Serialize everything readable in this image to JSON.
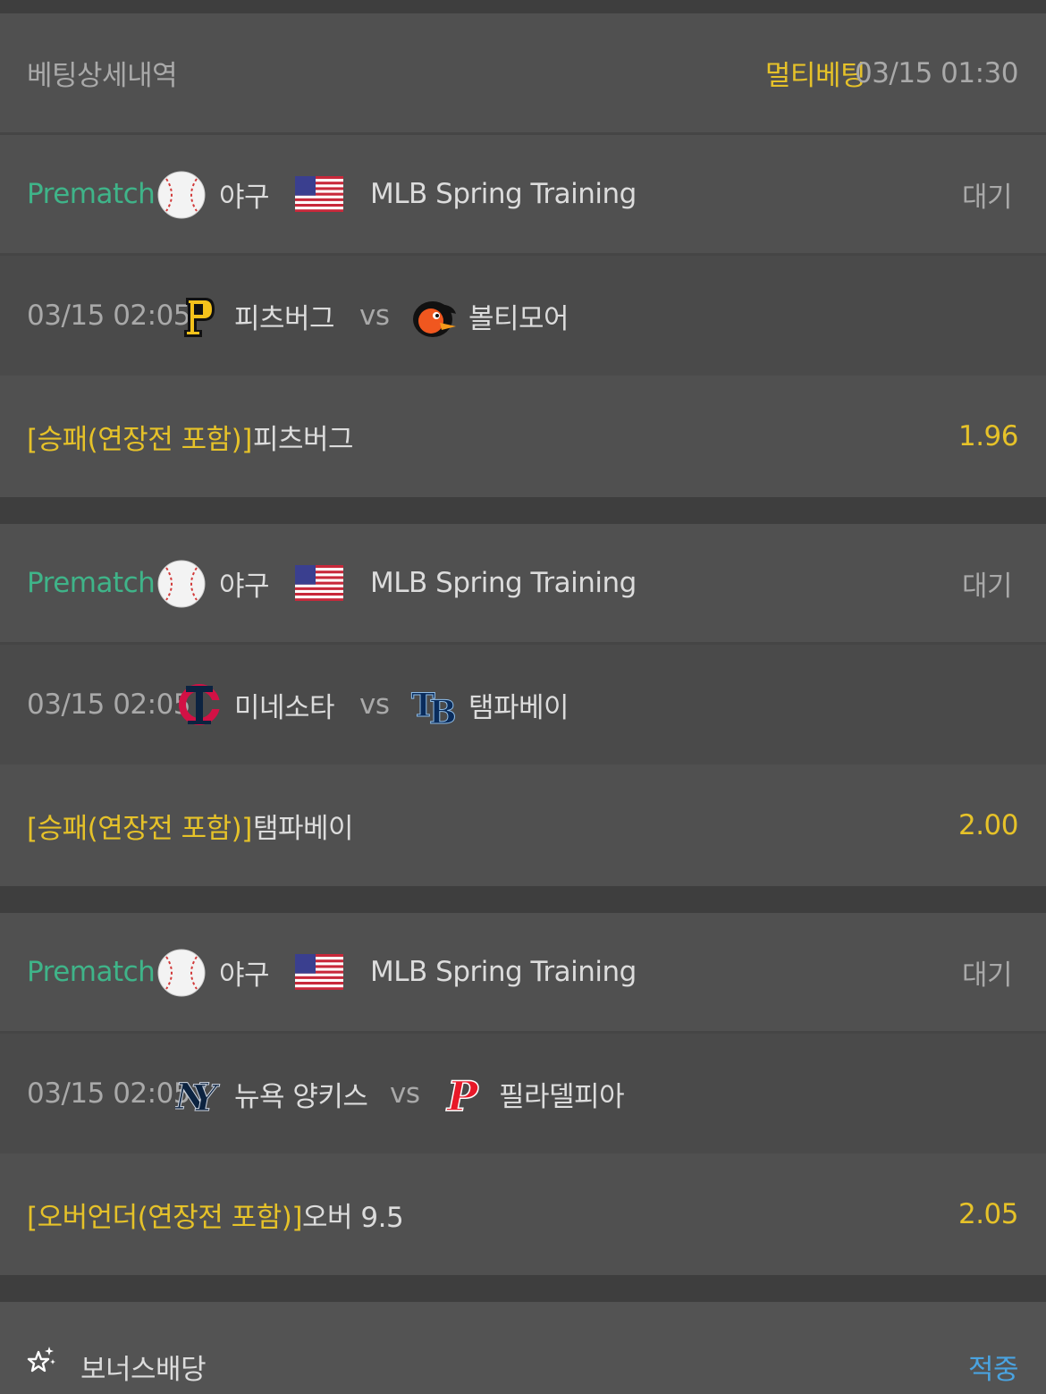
{
  "header": {
    "title": "베팅상세내역",
    "bet_type": "멀티베팅",
    "datetime": "03/15 01:30"
  },
  "bets": [
    {
      "type": "Prematch",
      "sport": "야구",
      "league": "MLB Spring Training",
      "status": "대기",
      "match_time": "03/15 02:05",
      "home": "피츠버그",
      "vs": "vs",
      "away": "볼티모어",
      "market": "[승패(연장전 포함)]",
      "pick": "피츠버그",
      "odds": "1.96"
    },
    {
      "type": "Prematch",
      "sport": "야구",
      "league": "MLB Spring Training",
      "status": "대기",
      "match_time": "03/15 02:05",
      "home": "미네소타",
      "vs": "vs",
      "away": "탬파베이",
      "market": "[승패(연장전 포함)]",
      "pick": "탬파베이",
      "odds": "2.00"
    },
    {
      "type": "Prematch",
      "sport": "야구",
      "league": "MLB Spring Training",
      "status": "대기",
      "match_time": "03/15 02:05",
      "home": "뉴욕 양키스",
      "vs": "vs",
      "away": "필라델피아",
      "market": "[오버언더(연장전 포함)]",
      "pick": "오버 9.5",
      "odds": "2.05"
    }
  ],
  "bonus": {
    "label": "보너스배당",
    "status": "적중"
  },
  "icons": {
    "sport": "baseball-icon",
    "flag": "usa-flag-icon",
    "bonus": "star-sparkle-icon"
  },
  "colors": {
    "accent_green": "#3fb489",
    "accent_yellow": "#e6c229",
    "accent_blue": "#4aa3e0"
  }
}
